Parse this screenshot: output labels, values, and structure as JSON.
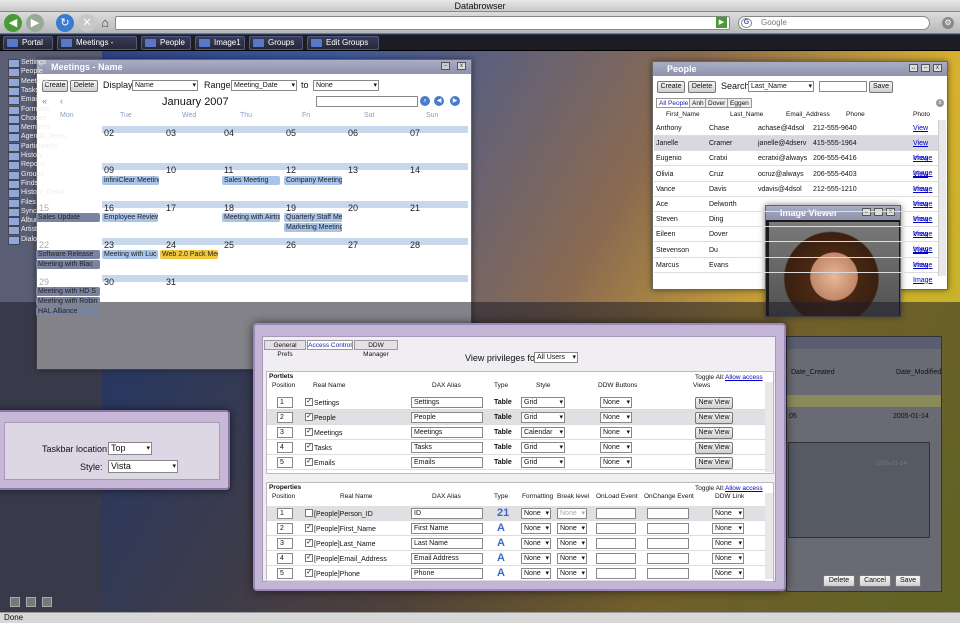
{
  "browser": {
    "title": "Databrowser",
    "search_placeholder": "Google",
    "status": "Done"
  },
  "taskbar": [
    "Portal",
    "Meetings - Name",
    "People",
    "Image1",
    "Groups",
    "Edit Groups 1"
  ],
  "sidebar": [
    "Settings",
    "People",
    "Meetings",
    "Tasks",
    "Emails",
    "Formulas",
    "Choices",
    "Members",
    "Agenda_Items",
    "Participants",
    "History",
    "Reports",
    "Groups",
    "Finds",
    "History_Detail",
    "Files",
    "Syncs",
    "Album",
    "Artist",
    "Dialog"
  ],
  "meetings": {
    "title": "Meetings - Name",
    "create": "Create",
    "delete": "Delete",
    "display_label": "Display",
    "display_value": "Name",
    "range_label": "Range",
    "range_value": "Meeting_Date",
    "to_label": "to",
    "to_value": "None",
    "month": "January 2007",
    "weekdays": [
      "Mon",
      "Tue",
      "Wed",
      "Thu",
      "Fri",
      "Sat",
      "Sun"
    ],
    "weeks": [
      [
        "02",
        "03",
        "04",
        "05",
        "06",
        "07"
      ],
      [
        "09",
        "10",
        "11",
        "12",
        "13",
        "14"
      ],
      [
        "16",
        "17",
        "18",
        "19",
        "20",
        "21"
      ],
      [
        "23",
        "24",
        "25",
        "26",
        "27",
        "28"
      ],
      [
        "30",
        "31"
      ]
    ],
    "week_left": [
      "15",
      "22",
      "29"
    ],
    "events": {
      "e1": "infiniClear Meeting",
      "e2": "Sales Meeting",
      "e3": "Company Meeting",
      "e4": "Employee Review",
      "e5": "Meeting with Airtra",
      "e6": "Quarterly Staff Me",
      "e7": "Marketing Meeting",
      "e8": "Meeting with Luc",
      "e9": "Web 2.0 Pack Mee",
      "e10": "Sales Update",
      "e11": "Software Release",
      "e12": "Meeting with Blac",
      "e13": "Meeting with HD S",
      "e14": "Meeting with Robin",
      "e15": "HAL Alliance"
    }
  },
  "people": {
    "title": "People",
    "create": "Create",
    "delete": "Delete",
    "search_label": "Search",
    "search_field": "Last_Name",
    "save": "Save",
    "tabs": [
      "All People",
      "Anh",
      "Dover",
      "Eggen"
    ],
    "columns": [
      "First_Name",
      "Last_Name",
      "Email_Address",
      "Phone",
      "Photo"
    ],
    "rows": [
      [
        "Anthony",
        "Chase",
        "achase@4dsol",
        "212-555-9640",
        "View Image"
      ],
      [
        "Janelle",
        "Cramer",
        "janelle@4dserv",
        "415-555-1964",
        "View Image"
      ],
      [
        "Eugenio",
        "Cratxi",
        "ecratxi@always",
        "206-555-6416",
        "View Image"
      ],
      [
        "Olivia",
        "Cruz",
        "ocruz@always",
        "206-555-6403",
        "View Image"
      ],
      [
        "Vance",
        "Davis",
        "vdavis@4dsol",
        "212-555-1210",
        "View Image"
      ],
      [
        "Ace",
        "Delworth",
        "",
        "",
        "View Image"
      ],
      [
        "Steven",
        "Ding",
        "",
        "",
        "View Image"
      ],
      [
        "Eileen",
        "Dover",
        "",
        "",
        "View Image"
      ],
      [
        "Stevenson",
        "Du",
        "",
        "",
        "View Image"
      ],
      [
        "Marcus",
        "Evans",
        "",
        "",
        "View Image"
      ]
    ]
  },
  "image_viewer": {
    "title": "Image Viewer"
  },
  "groups": {
    "col_created": "Date_Created",
    "col_modified": "Date_Modified",
    "row_created": "05",
    "row_modified": "2005-01-14",
    "faded_date": "2005-01-14",
    "delete": "Delete",
    "cancel": "Cancel",
    "save": "Save"
  },
  "taskbar_prefs": {
    "location_label": "Taskbar location:",
    "location_value": "Top",
    "style_label": "Style:",
    "style_value": "Vista"
  },
  "prefs": {
    "tabs": [
      "General Prefs",
      "Access Control",
      "DDW Manager"
    ],
    "view_label": "View privileges for:",
    "view_value": "All Users",
    "portlets_title": "Portlets",
    "toggle_label": "Toggle All:",
    "toggle_link": "Allow access",
    "portlet_columns": [
      "Position",
      "Real Name",
      "DAX Alias",
      "Type",
      "Style",
      "DDW Buttons",
      "Views"
    ],
    "portlets": [
      [
        "1",
        "Settings",
        "Settings",
        "Table",
        "Grid",
        "None",
        "New View"
      ],
      [
        "2",
        "People",
        "People",
        "Table",
        "Grid",
        "None",
        "New View"
      ],
      [
        "3",
        "Meetings",
        "Meetings",
        "Table",
        "Calendar",
        "None",
        "New View"
      ],
      [
        "4",
        "Tasks",
        "Tasks",
        "Table",
        "Grid",
        "None",
        "New View"
      ],
      [
        "5",
        "Emails",
        "Emails",
        "Table",
        "Grid",
        "None",
        "New View"
      ]
    ],
    "properties_title": "Properties",
    "prop_columns": [
      "Position",
      "Real Name",
      "DAX Alias",
      "Type",
      "Formatting",
      "Break level",
      "OnLoad Event",
      "OnChange Event",
      "DDW Link"
    ],
    "properties": [
      [
        "1",
        "[People]Person_ID",
        "ID",
        "21",
        "None",
        "None",
        "None"
      ],
      [
        "2",
        "[People]First_Name",
        "First Name",
        "A",
        "None",
        "None",
        "None"
      ],
      [
        "3",
        "[People]Last_Name",
        "Last Name",
        "A",
        "None",
        "None",
        "None"
      ],
      [
        "4",
        "[People]Email_Address",
        "Email Address",
        "A",
        "None",
        "None",
        "None"
      ],
      [
        "5",
        "[People]Phone",
        "Phone",
        "A",
        "None",
        "None",
        "None"
      ]
    ]
  }
}
